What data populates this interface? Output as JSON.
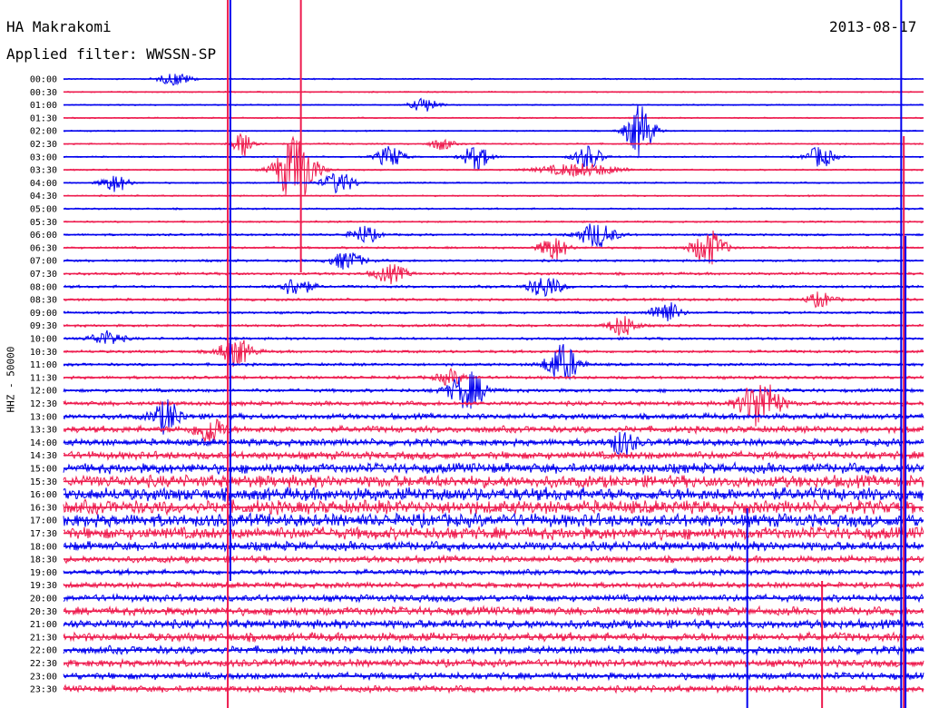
{
  "station": "HA Makrakomi",
  "filter_label": "Applied filter: WWSSN-SP",
  "date": "2013-08-17",
  "colors": {
    "trace_a": "#0000ee",
    "trace_b": "#ee1b4e"
  },
  "chart_data": {
    "type": "line",
    "title": "HA Makrakomi",
    "ylabel": "HHZ - 50000",
    "row_labels": [
      "00:00",
      "00:30",
      "01:00",
      "01:30",
      "02:00",
      "02:30",
      "03:00",
      "03:30",
      "04:00",
      "04:30",
      "05:00",
      "05:30",
      "06:00",
      "06:30",
      "07:00",
      "07:30",
      "08:00",
      "08:30",
      "09:00",
      "09:30",
      "10:00",
      "10:30",
      "11:00",
      "11:30",
      "12:00",
      "12:30",
      "13:00",
      "13:30",
      "14:00",
      "14:30",
      "15:00",
      "15:30",
      "16:00",
      "16:30",
      "17:00",
      "17:30",
      "18:00",
      "18:30",
      "19:00",
      "19:30",
      "20:00",
      "20:30",
      "21:00",
      "21:30",
      "22:00",
      "22:30",
      "23:00",
      "23:30"
    ],
    "row_noise": [
      0.6,
      0.6,
      0.6,
      0.6,
      0.6,
      0.7,
      0.7,
      0.7,
      0.7,
      0.7,
      0.8,
      0.8,
      1.0,
      1.0,
      1.1,
      1.2,
      1.2,
      1.2,
      1.1,
      1.2,
      1.2,
      1.3,
      1.3,
      1.4,
      1.6,
      2.0,
      2.6,
      3.0,
      3.2,
      3.6,
      4.6,
      5.6,
      6.0,
      6.2,
      6.0,
      5.6,
      4.2,
      3.0,
      2.4,
      2.6,
      3.2,
      3.8,
      4.0,
      4.0,
      3.6,
      3.4,
      3.2,
      3.0
    ],
    "events": [
      {
        "row": 0,
        "x": 0.13,
        "amp": 7,
        "width": 12
      },
      {
        "row": 2,
        "x": 0.42,
        "amp": 8,
        "width": 10
      },
      {
        "row": 4,
        "x": 0.67,
        "amp": 30,
        "width": 10
      },
      {
        "row": 5,
        "x": 0.44,
        "amp": 7,
        "width": 8
      },
      {
        "row": 5,
        "x": 0.21,
        "amp": 14,
        "width": 8
      },
      {
        "row": 6,
        "x": 0.88,
        "amp": 12,
        "width": 10
      },
      {
        "row": 6,
        "x": 0.61,
        "amp": 14,
        "width": 10
      },
      {
        "row": 6,
        "x": 0.48,
        "amp": 14,
        "width": 10
      },
      {
        "row": 6,
        "x": 0.38,
        "amp": 12,
        "width": 10
      },
      {
        "row": 7,
        "x": 0.27,
        "amp": 40,
        "width": 14
      },
      {
        "row": 7,
        "x": 0.6,
        "amp": 7,
        "width": 30
      },
      {
        "row": 8,
        "x": 0.32,
        "amp": 12,
        "width": 12
      },
      {
        "row": 8,
        "x": 0.06,
        "amp": 10,
        "width": 10
      },
      {
        "row": 12,
        "x": 0.62,
        "amp": 14,
        "width": 14
      },
      {
        "row": 12,
        "x": 0.35,
        "amp": 10,
        "width": 10
      },
      {
        "row": 13,
        "x": 0.57,
        "amp": 14,
        "width": 10
      },
      {
        "row": 13,
        "x": 0.75,
        "amp": 20,
        "width": 12
      },
      {
        "row": 14,
        "x": 0.33,
        "amp": 10,
        "width": 12
      },
      {
        "row": 15,
        "x": 0.38,
        "amp": 10,
        "width": 12
      },
      {
        "row": 16,
        "x": 0.56,
        "amp": 12,
        "width": 12
      },
      {
        "row": 16,
        "x": 0.27,
        "amp": 10,
        "width": 12
      },
      {
        "row": 17,
        "x": 0.88,
        "amp": 8,
        "width": 10
      },
      {
        "row": 18,
        "x": 0.7,
        "amp": 14,
        "width": 10
      },
      {
        "row": 19,
        "x": 0.65,
        "amp": 12,
        "width": 10
      },
      {
        "row": 20,
        "x": 0.05,
        "amp": 8,
        "width": 12
      },
      {
        "row": 21,
        "x": 0.2,
        "amp": 16,
        "width": 12
      },
      {
        "row": 22,
        "x": 0.58,
        "amp": 22,
        "width": 12
      },
      {
        "row": 23,
        "x": 0.45,
        "amp": 8,
        "width": 10
      },
      {
        "row": 24,
        "x": 0.47,
        "amp": 20,
        "width": 14
      },
      {
        "row": 25,
        "x": 0.81,
        "amp": 28,
        "width": 14
      },
      {
        "row": 26,
        "x": 0.12,
        "amp": 18,
        "width": 10
      },
      {
        "row": 27,
        "x": 0.17,
        "amp": 16,
        "width": 10
      },
      {
        "row": 28,
        "x": 0.65,
        "amp": 12,
        "width": 10
      }
    ],
    "spikes": [
      {
        "x": 0.191,
        "from": 0,
        "to": 780,
        "color": "trace_b"
      },
      {
        "x": 0.194,
        "from": 0,
        "to": 640,
        "color": "trace_a"
      },
      {
        "x": 0.276,
        "from": 0,
        "to": 300,
        "color": "trace_b"
      },
      {
        "x": 0.974,
        "from": 0,
        "to": 780,
        "color": "trace_a"
      },
      {
        "x": 0.977,
        "from": 150,
        "to": 780,
        "color": "trace_b"
      },
      {
        "x": 0.979,
        "from": 260,
        "to": 780,
        "color": "trace_a"
      },
      {
        "x": 0.795,
        "from": 560,
        "to": 780,
        "color": "trace_a"
      },
      {
        "x": 0.882,
        "from": 640,
        "to": 780,
        "color": "trace_b"
      }
    ]
  }
}
